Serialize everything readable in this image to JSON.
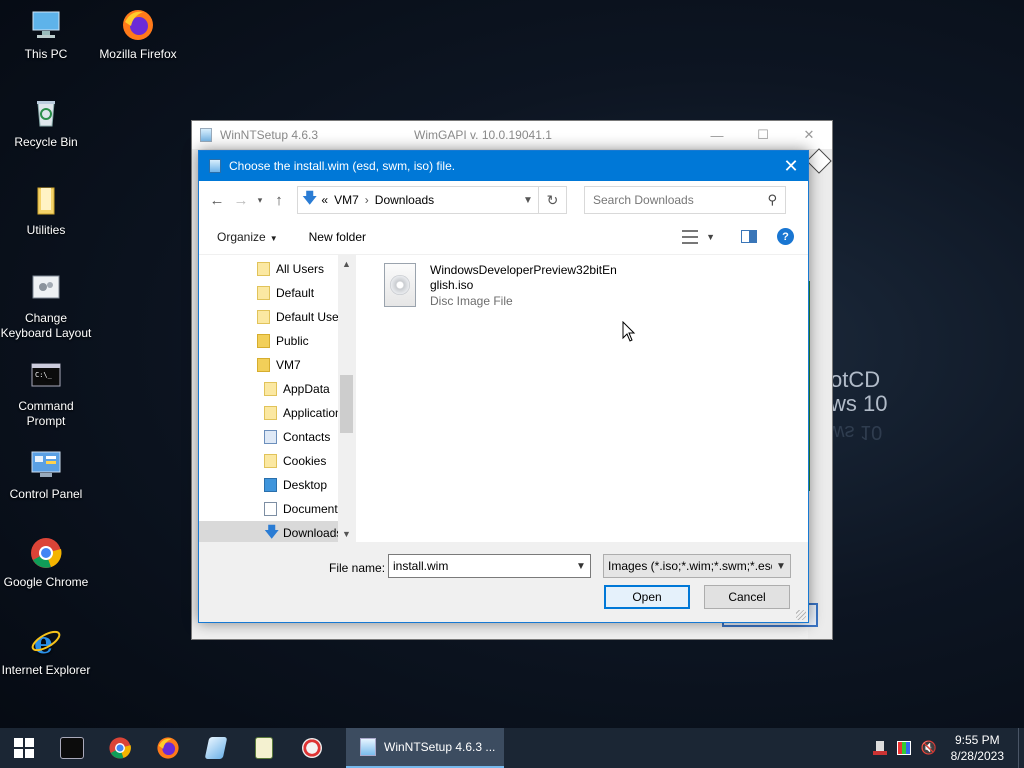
{
  "desktop": {
    "background_text": [
      "otCD",
      "ws 10"
    ],
    "icons": [
      {
        "label": "This PC",
        "icon": "this-pc-icon"
      },
      {
        "label": "Mozilla Firefox",
        "icon": "firefox-icon"
      },
      {
        "label": "Recycle Bin",
        "icon": "recycle-bin-icon"
      },
      {
        "label": "Utilities",
        "icon": "folder-icon"
      },
      {
        "label": "Change Keyboard Layout",
        "icon": "keyboard-icon"
      },
      {
        "label": "Command Prompt",
        "icon": "cmd-icon"
      },
      {
        "label": "Control Panel",
        "icon": "control-panel-icon"
      },
      {
        "label": "Google Chrome",
        "icon": "chrome-icon"
      },
      {
        "label": "Internet Explorer",
        "icon": "ie-icon"
      }
    ]
  },
  "winntsetup": {
    "title": "WinNTSetup 4.6.3",
    "wimgapi": "WimGAPI v. 10.0.19041.1"
  },
  "dialog": {
    "title": "Choose the install.wim (esd, swm, iso) file.",
    "address": {
      "prefix": "«",
      "segments": [
        "VM7",
        "Downloads"
      ]
    },
    "search_placeholder": "Search Downloads",
    "toolbar": {
      "organize": "Organize",
      "new_folder": "New folder"
    },
    "tree": [
      {
        "label": "All Users",
        "icon": "folder",
        "indent": 1,
        "selected": false
      },
      {
        "label": "Default",
        "icon": "folder",
        "indent": 1,
        "selected": false
      },
      {
        "label": "Default User",
        "icon": "folder",
        "indent": 1,
        "selected": false
      },
      {
        "label": "Public",
        "icon": "folder",
        "indent": 1,
        "selected": false
      },
      {
        "label": "VM7",
        "icon": "folder",
        "indent": 1,
        "selected": false
      },
      {
        "label": "AppData",
        "icon": "folder",
        "indent": 2,
        "selected": false
      },
      {
        "label": "Application Data",
        "icon": "folder",
        "indent": 2,
        "selected": false
      },
      {
        "label": "Contacts",
        "icon": "contacts",
        "indent": 2,
        "selected": false
      },
      {
        "label": "Cookies",
        "icon": "folder",
        "indent": 2,
        "selected": false
      },
      {
        "label": "Desktop",
        "icon": "desktop",
        "indent": 2,
        "selected": false
      },
      {
        "label": "Documents",
        "icon": "documents",
        "indent": 2,
        "selected": false
      },
      {
        "label": "Downloads",
        "icon": "downloads",
        "indent": 2,
        "selected": true
      }
    ],
    "files": [
      {
        "name": "WindowsDeveloperPreview32bitEnglish.iso",
        "type": "Disc Image File"
      }
    ],
    "file_name_label": "File name:",
    "file_name_value": "install.wim",
    "file_type_value": "Images (*.iso;*.wim;*.swm;*.esd)",
    "open_label": "Open",
    "cancel_label": "Cancel"
  },
  "taskbar": {
    "active_app": "WinNTSetup 4.6.3   ...",
    "time": "9:55 PM",
    "date": "8/28/2023"
  }
}
